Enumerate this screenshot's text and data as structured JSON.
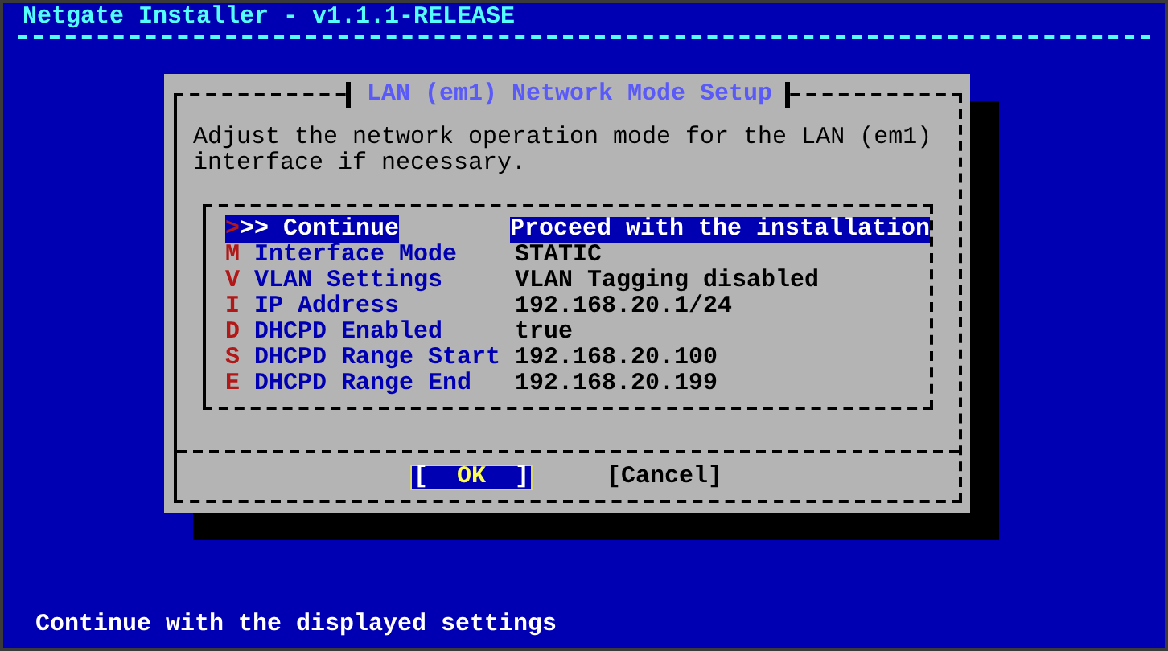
{
  "header": {
    "title": "Netgate Installer - v1.1.1-RELEASE"
  },
  "dialog": {
    "title": "LAN (em1) Network Mode Setup",
    "message": [
      "Adjust the network operation mode for the LAN (em1)",
      "interface if necessary."
    ],
    "items": [
      {
        "name": ">>> Continue",
        "value": "Proceed with the installation",
        "selected": true
      },
      {
        "name": "M Interface Mode",
        "value": "STATIC",
        "selected": false
      },
      {
        "name": "V VLAN Settings",
        "value": "VLAN Tagging disabled",
        "selected": false
      },
      {
        "name": "I IP Address",
        "value": "192.168.20.1/24",
        "selected": false
      },
      {
        "name": "D DHCPD Enabled",
        "value": "true",
        "selected": false
      },
      {
        "name": "S DHCPD Range Start",
        "value": "192.168.20.100",
        "selected": false
      },
      {
        "name": "E DHCPD Range End",
        "value": "192.168.20.199",
        "selected": false
      }
    ],
    "buttons": [
      {
        "label": "[  OK  ]",
        "selected": true
      },
      {
        "label": "[Cancel]",
        "selected": false
      }
    ]
  },
  "status_bar": "Continue with the displayed settings"
}
